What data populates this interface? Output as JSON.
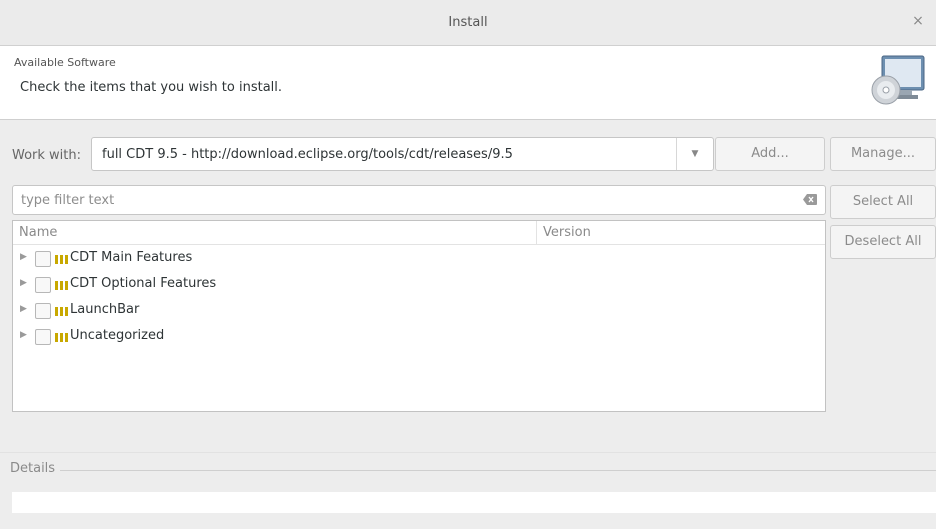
{
  "window": {
    "title": "Install",
    "close_glyph": "×"
  },
  "banner": {
    "heading": "Available Software",
    "description": "Check the items that you wish to install.",
    "icon": "install-software-icon"
  },
  "work_with": {
    "label": "Work with:",
    "value": "full CDT 9.5 - http://download.eclipse.org/tools/cdt/releases/9.5",
    "add_label": "Add...",
    "manage_label": "Manage..."
  },
  "filter": {
    "placeholder": "type filter text",
    "value": ""
  },
  "buttons": {
    "select_all": "Select All",
    "deselect_all": "Deselect All"
  },
  "tree": {
    "columns": [
      "Name",
      "Version"
    ],
    "items": [
      {
        "label": "CDT Main Features",
        "checked": false
      },
      {
        "label": "CDT Optional Features",
        "checked": false
      },
      {
        "label": "LaunchBar",
        "checked": false
      },
      {
        "label": "Uncategorized",
        "checked": false
      }
    ]
  },
  "details": {
    "label": "Details"
  },
  "colors": {
    "category_icon": "#c8a800",
    "background": "#ededed"
  }
}
